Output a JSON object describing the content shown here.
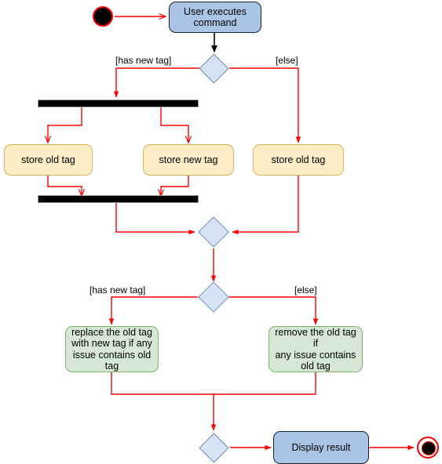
{
  "diagram": {
    "title": "UML Activity Diagram",
    "colors": {
      "edge": "#ff0000",
      "edge_alt": "#000000",
      "blue_fill": "#a9c4e4",
      "blue_stroke": "#16222e",
      "yellow_fill": "#fdeec7",
      "yellow_stroke": "#d9b25a",
      "green_fill": "#d6e8d5",
      "green_stroke": "#81b267",
      "diamond_fill": "#d5e3f5",
      "diamond_stroke": "#6c8ebf",
      "bar_fill": "#000000",
      "start_fill": "#000000",
      "start_stroke": "#ff0000"
    },
    "nodes": {
      "start": {
        "name": "initial-node",
        "label": ""
      },
      "user_executes_command": {
        "label": "User executes\ncommand"
      },
      "decision_1": {
        "label": ""
      },
      "fork_bar": {
        "label": ""
      },
      "store_old_tag_left": {
        "label": "store old tag"
      },
      "store_new_tag": {
        "label": "store new tag"
      },
      "store_old_tag_right": {
        "label": "store old tag"
      },
      "join_bar": {
        "label": ""
      },
      "merge_1": {
        "label": ""
      },
      "decision_2": {
        "label": ""
      },
      "replace_old_tag": {
        "label": "replace the old tag\nwith new tag if any\nissue contains old tag"
      },
      "remove_old_tag": {
        "label": "remove the old tag  if\nany issue contains\nold tag"
      },
      "merge_2": {
        "label": ""
      },
      "display_result": {
        "label": "Display result"
      },
      "end": {
        "name": "final-node",
        "label": ""
      }
    },
    "edge_labels": {
      "d1_has_new_tag": "[has new tag]",
      "d1_else": "[else]",
      "d2_has_new_tag": "[has new tag]",
      "d2_else": "[else]"
    }
  }
}
